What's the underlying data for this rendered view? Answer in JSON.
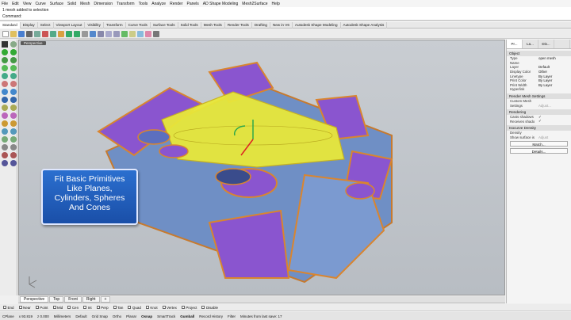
{
  "menu": [
    "File",
    "Edit",
    "View",
    "Curve",
    "Surface",
    "Solid",
    "Mesh",
    "Dimension",
    "Transform",
    "Tools",
    "Analyze",
    "Render",
    "Panels",
    "AD Shape Modeling",
    "Mesh2Surface",
    "Help"
  ],
  "command": {
    "history": "1 mesh added to selection",
    "prompt": "Command:"
  },
  "toolbar_tabs": [
    "Standard",
    "Display",
    "Select",
    "Viewport Layout",
    "Visibility",
    "Transform",
    "Curve Tools",
    "Surface Tools",
    "Solid Tools",
    "Mesh Tools",
    "Render Tools",
    "Drafting",
    "New in V6",
    "Autodesk Shape Modeling",
    "Autodesk Shape Analysis"
  ],
  "viewport": {
    "label": "Perspective"
  },
  "callout": {
    "lines": [
      "Fit Basic Primitives",
      "Like Planes,",
      "Cylinders, Spheres",
      "And Cones"
    ]
  },
  "viewport_tabs": [
    "Perspective",
    "Top",
    "Front",
    "Right",
    "+"
  ],
  "osnaps": [
    "End",
    "Near",
    "Point",
    "Mid",
    "Cen",
    "Int",
    "Perp",
    "Tan",
    "Quad",
    "Knot",
    "Vertex",
    "Project",
    "Disable"
  ],
  "status": {
    "cplane": "CPlane",
    "x": "x 93.819",
    "y": "z 0.000",
    "units": "Millimeters",
    "layer": "Default",
    "toggles": [
      "Grid Snap",
      "Ortho",
      "Planar",
      "Osnap",
      "SmartTrack",
      "Gumball",
      "Record History",
      "Filter"
    ],
    "active_toggles": [
      "Osnap",
      "Gumball"
    ],
    "message": "Minutes from last save: 17"
  },
  "right_panel": {
    "tabs": [
      "Pr...",
      "La...",
      "Dis...",
      ""
    ],
    "object_header": "Object",
    "object_rows": [
      {
        "k": "Type",
        "v": "open mesh"
      },
      {
        "k": "Name",
        "v": ""
      },
      {
        "k": "Layer",
        "v": "Default"
      },
      {
        "k": "Display Color",
        "v": "Other"
      },
      {
        "k": "Linetype",
        "v": "By Layer"
      },
      {
        "k": "Print Color",
        "v": "By Layer"
      },
      {
        "k": "Print Width",
        "v": "By Layer"
      },
      {
        "k": "Hyperlink",
        "v": ""
      }
    ],
    "render_mesh_header": "Render Mesh Settings",
    "render_mesh_rows": [
      {
        "k": "Custom Mesh",
        "v": ""
      },
      {
        "k": "Settings",
        "v": "Adjust..."
      }
    ],
    "rendering_header": "Rendering",
    "rendering_rows": [
      {
        "k": "Casts shadows",
        "v": "✓"
      },
      {
        "k": "Receives shado",
        "v": "✓"
      }
    ],
    "isocurve_header": "Isocurve Density",
    "isocurve_rows": [
      {
        "k": "Density",
        "v": ""
      },
      {
        "k": "Show surface is",
        "v": "Adjust"
      }
    ],
    "match_button": "Match...",
    "details_button": "Details..."
  },
  "colors": {
    "callout": "#1f5fc0",
    "mesh_yellow": "#e8e83a",
    "mesh_purple": "#7b52c9",
    "mesh_orange": "#d98a3a"
  }
}
